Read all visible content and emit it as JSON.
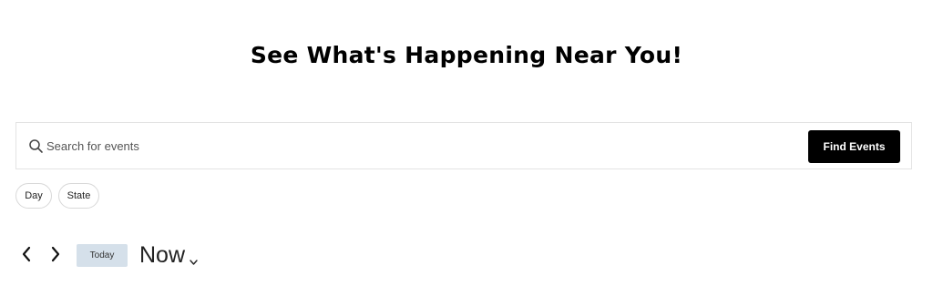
{
  "header": {
    "title": "See What's Happening Near You!"
  },
  "search": {
    "placeholder": "Search for events",
    "value": "",
    "submit_label": "Find Events",
    "icon": "search-icon"
  },
  "filters": {
    "items": [
      {
        "label": "Day"
      },
      {
        "label": "State"
      }
    ]
  },
  "date_nav": {
    "prev_icon": "chevron-left-icon",
    "next_icon": "chevron-right-icon",
    "today_label": "Today",
    "range_label": "Now",
    "range_icon": "chevron-down-icon"
  },
  "colors": {
    "button_bg": "#000000",
    "today_bg": "#d5e0ea"
  }
}
